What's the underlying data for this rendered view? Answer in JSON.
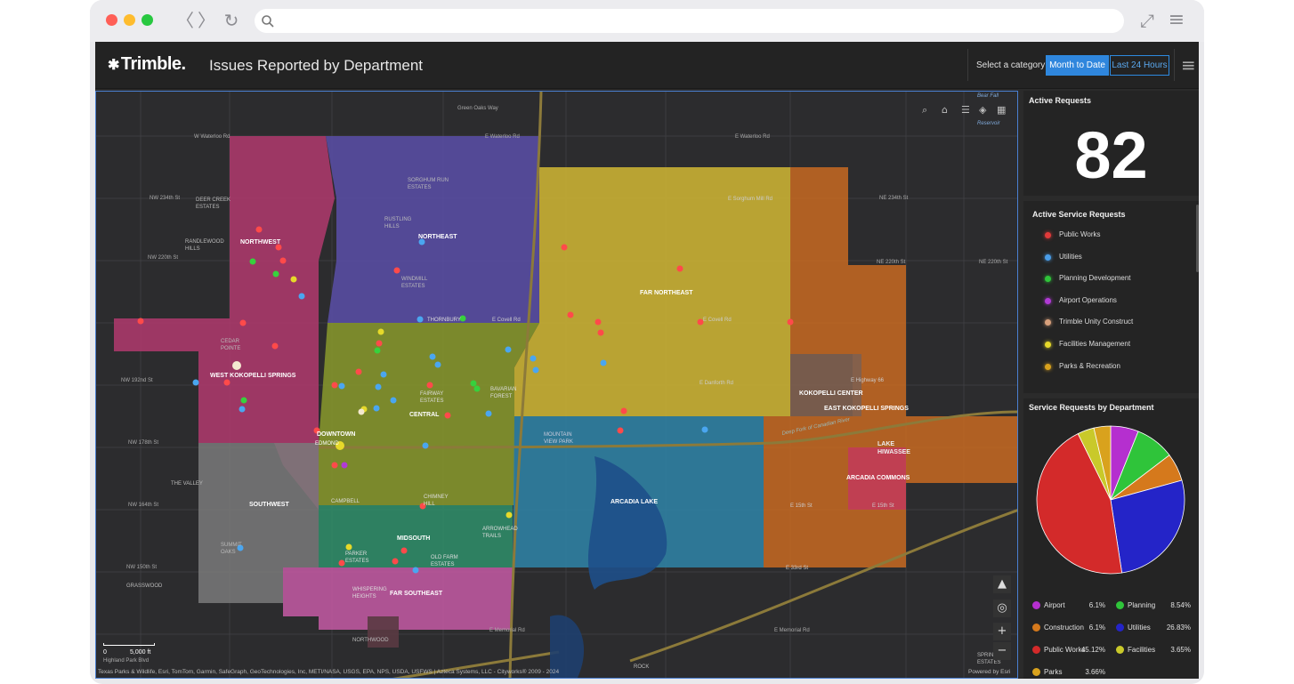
{
  "browser": {
    "back_glyph": "〈",
    "forward_glyph": "〉",
    "reload_glyph": "↻",
    "expand_glyph": "⤢",
    "menu_glyph": "≡",
    "colors": {
      "close": "#ff5f57",
      "minimize": "#febc2e",
      "maximize": "#28c840"
    }
  },
  "header": {
    "logo": "Trimble.",
    "title": "Issues Reported by Department",
    "select_label": "Select a category",
    "tabs": [
      {
        "label": "Month to Date",
        "active": true
      },
      {
        "label": "Last 24 Hours",
        "active": false
      }
    ],
    "menu_glyph": "≡"
  },
  "map": {
    "labels": {
      "northwest": "NORTHWEST",
      "northeast": "NORTHEAST",
      "far_northeast": "FAR NORTHEAST",
      "west_kokopelli": "WEST KOKOPELLI SPRINGS",
      "central": "CENTRAL",
      "downtown": "DOWNTOWN",
      "kokopelli_center": "KOKOPELLI CENTER",
      "east_kokopelli": "EAST KOKOPELLI SPRINGS",
      "southwest": "SOUTHWEST",
      "arcadia_lake": "ARCADIA LAKE",
      "arcadia_commons": "ARCADIA COMMONS",
      "midsouth": "MIDSOUTH",
      "far_southeast": "FAR SOUTHEAST",
      "lake_hiwassee": "LAKE HIWASSEE",
      "deer_creek": "DEER CREEK ESTATES",
      "randlewood": "RANDLEWOOD HILLS",
      "sorghum_run": "SORGHUM RUN ESTATES",
      "rustling_hills": "RUSTLING HILLS",
      "windmill": "WINDMILL ESTATES",
      "cedar_pointe": "CEDAR POINTE",
      "the_valley": "THE VALLEY",
      "grasswood": "GRASSWOOD",
      "northwood": "NORTHWOOD",
      "rock": "ROCK",
      "spring_estates": "SPRIN... ESTATES",
      "parker_estates": "PARKER ESTATES",
      "whispering_heights": "WHISPERING HEIGHTS",
      "campbell": "CAMPBELL",
      "chimney_hill": "CHIMNEY HILL",
      "arrowhead_trails": "ARROWHEAD TRAILS",
      "mountain_view_park": "MOUNTAIN VIEW PARK",
      "fairway_estates": "FAIRWAY ESTATES",
      "bavarian_forest": "BAVARIAN FOREST",
      "thornbury": "THORNBURY",
      "edmond": "EDMOND",
      "old_farm": "OLD FARM ESTATES",
      "summit_oaks": "SUMMIT OAKS"
    },
    "roads": {
      "waterloo_w": "W Waterloo Rd",
      "waterloo_e": "E Waterloo Rd",
      "green_oaks": "Green Oaks Way",
      "nw_234": "NW 234th St",
      "ne_234": "NE 234th St",
      "nw_220": "NW 220th St",
      "ne_220": "NE 220th St",
      "sorghum_mill": "E Sorghum Mill Rd",
      "covell": "E Covell Rd",
      "danforth": "E Danforth Rd",
      "nw_192": "NW 192nd St",
      "nw_178": "NW 178th St",
      "nw_164": "NW 164th St",
      "nw_150": "NW 150th St",
      "e_15th": "E 15th St",
      "e_33rd": "E 33rd St",
      "memorial": "E Memorial Rd",
      "highway": "E Highway 66",
      "bear_fall": "Bear Fall",
      "reservoir": "Reservoir",
      "deep_fork": "Deep Fork of Canadian River"
    },
    "scale": {
      "start": "0",
      "end": "5,000 ft",
      "street": "Highland Park Blvd"
    },
    "attribution": "Texas Parks & Wildlife, Esri, TomTom, Garmin, SafeGraph, GeoTechnologies, Inc, METI/NASA, USGS, EPA, NPS, USDA, USFWS | Azteca Systems, LLC - Cityworks® 2009 - 2024",
    "powered_by": "Powered by Esri"
  },
  "active_requests": {
    "title": "Active Requests",
    "count": "82"
  },
  "service_requests": {
    "title": "Active Service Requests",
    "items": [
      {
        "label": "Public Works",
        "color": "#e23a3a"
      },
      {
        "label": "Utilities",
        "color": "#4a9de8"
      },
      {
        "label": "Planning Development",
        "color": "#2fc43a"
      },
      {
        "label": "Airport Operations",
        "color": "#b13ad6"
      },
      {
        "label": "Trimble Unity Construct",
        "color": "#d8a07c"
      },
      {
        "label": "Facilities Management",
        "color": "#e6d92a"
      },
      {
        "label": "Parks & Recreation",
        "color": "#d9a21d"
      }
    ]
  },
  "by_department": {
    "title": "Service Requests by Department"
  },
  "chart_data": {
    "type": "pie",
    "title": "Service Requests by Department",
    "slices": [
      {
        "name": "Airport",
        "value": 6.1,
        "label": "6.1%",
        "color": "#b52fcf"
      },
      {
        "name": "Planning",
        "value": 8.54,
        "label": "8.54%",
        "color": "#2fc43a"
      },
      {
        "name": "Construction",
        "value": 6.1,
        "label": "6.1%",
        "color": "#d5791c"
      },
      {
        "name": "Utilities",
        "value": 26.83,
        "label": "26.83%",
        "color": "#2424c8"
      },
      {
        "name": "Public Works",
        "value": 45.12,
        "label": "45.12%",
        "color": "#d32a2a"
      },
      {
        "name": "Facilities",
        "value": 3.65,
        "label": "3.65%",
        "color": "#c9c92a"
      },
      {
        "name": "Parks",
        "value": 3.66,
        "label": "3.66%",
        "color": "#d9a21d"
      }
    ]
  }
}
